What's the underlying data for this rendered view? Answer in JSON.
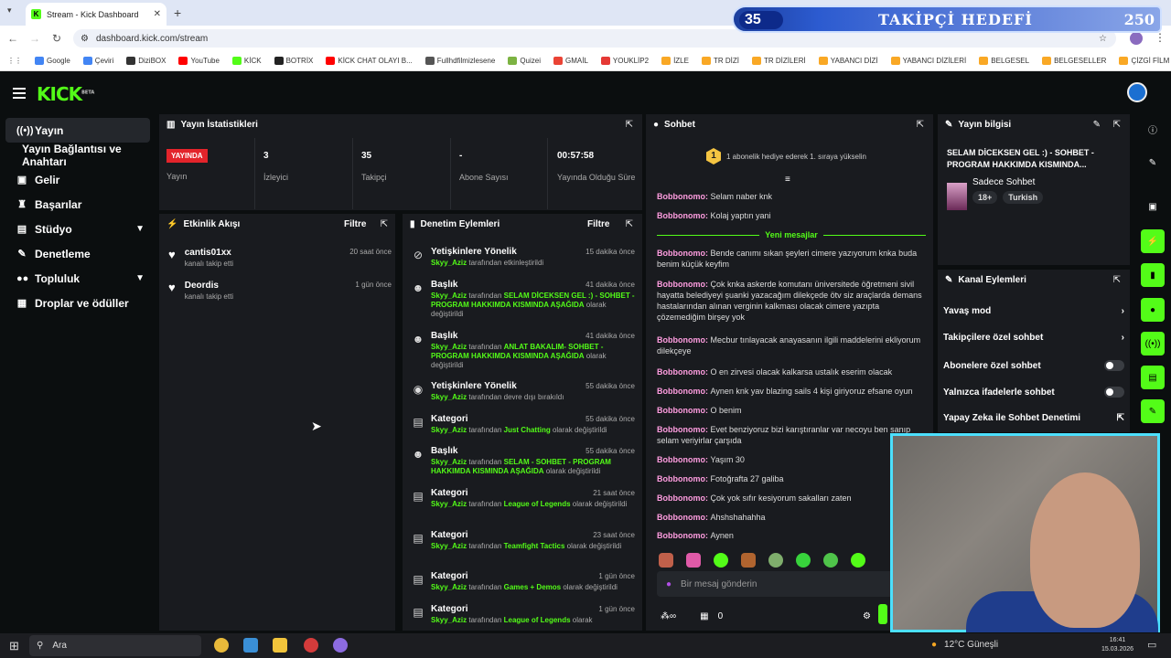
{
  "browser": {
    "tab_title": "Stream - Kick Dashboard",
    "url": "dashboard.kick.com/stream",
    "bookmarks": [
      {
        "label": "Google",
        "color": "#4285f4"
      },
      {
        "label": "Çeviri",
        "color": "#4285f4"
      },
      {
        "label": "DiziBOX",
        "color": "#333333"
      },
      {
        "label": "YouTube",
        "color": "#ff0000"
      },
      {
        "label": "KİCK",
        "color": "#53fc18"
      },
      {
        "label": "BOTRİX",
        "color": "#222222"
      },
      {
        "label": "KİCK CHAT OLAYI B...",
        "color": "#ff0000"
      },
      {
        "label": "Fullhdfilmizlesene",
        "color": "#555555"
      },
      {
        "label": "Quizei",
        "color": "#7cb342"
      },
      {
        "label": "GMAİL",
        "color": "#ea4335"
      },
      {
        "label": "YOUKLİP2",
        "color": "#e53935"
      },
      {
        "label": "İZLE",
        "color": "#f9a825"
      },
      {
        "label": "TR DİZİ",
        "color": "#f9a825"
      },
      {
        "label": "TR DİZİLERİ",
        "color": "#f9a825"
      },
      {
        "label": "YABANCI DİZİ",
        "color": "#f9a825"
      },
      {
        "label": "YABANCI DİZİLERİ",
        "color": "#f9a825"
      },
      {
        "label": "BELGESEL",
        "color": "#f9a825"
      },
      {
        "label": "BELGESELLER",
        "color": "#f9a825"
      },
      {
        "label": "ÇİZGİ FİLM",
        "color": "#f9a825"
      }
    ]
  },
  "overlay": {
    "goal_count": "35",
    "goal_label": "TAKİPÇİ HEDEFİ",
    "goal_target": "250"
  },
  "brand": {
    "logo": "KICK",
    "beta": "BETA",
    "accent": "#53fc18"
  },
  "sidebar": {
    "items": [
      {
        "label": "Yayın",
        "icon": "live-icon"
      },
      {
        "label": "Yayın Bağlantısı ve Anahtarı",
        "icon": ""
      },
      {
        "label": "Gelir",
        "icon": "wallet-icon"
      },
      {
        "label": "Başarılar",
        "icon": "trophy-icon"
      },
      {
        "label": "Stüdyo",
        "icon": "studio-icon"
      },
      {
        "label": "Denetleme",
        "icon": "wrench-icon"
      },
      {
        "label": "Topluluk",
        "icon": "community-icon"
      },
      {
        "label": "Droplar ve ödüller",
        "icon": "gift-icon"
      }
    ]
  },
  "stats": {
    "title": "Yayın İstatistikleri",
    "live_badge": "YAYINDA",
    "cols": [
      {
        "value": "",
        "label": "Yayın"
      },
      {
        "value": "3",
        "label": "İzleyici"
      },
      {
        "value": "35",
        "label": "Takipçi"
      },
      {
        "value": "-",
        "label": "Abone Sayısı"
      },
      {
        "value": "00:57:58",
        "label": "Yayında Olduğu Süre"
      }
    ]
  },
  "events": {
    "title": "Etkinlik Akışı",
    "filter": "Filtre",
    "items": [
      {
        "name": "cantis01xx",
        "sub": "kanalı takip etti",
        "time": "20 saat önce"
      },
      {
        "name": "Deordis",
        "sub": "kanalı takip etti",
        "time": "1 gün önce"
      }
    ]
  },
  "mod": {
    "title": "Denetim Eylemleri",
    "filter": "Filtre",
    "items": [
      {
        "title": "Yetişkinlere Yönelik",
        "time": "15 dakika önce",
        "user": "Skyy_Aziz",
        "pre": " tarafından etkinleştirildi",
        "val": "",
        "post": ""
      },
      {
        "title": "Başlık",
        "time": "41 dakika önce",
        "user": "Skyy_Aziz",
        "pre": " tarafından ",
        "val": "SELAM DİCEKSEN GEL :) - SOHBET - PROGRAM HAKKIMDA KISMINDA AŞAĞIDA",
        "post": " olarak değiştirildi"
      },
      {
        "title": "Başlık",
        "time": "41 dakika önce",
        "user": "Skyy_Aziz",
        "pre": " tarafından ",
        "val": "ANLAT BAKALIM- SOHBET - PROGRAM HAKKIMDA KISMINDA AŞAĞIDA",
        "post": " olarak değiştirildi"
      },
      {
        "title": "Yetişkinlere Yönelik",
        "time": "55 dakika önce",
        "user": "Skyy_Aziz",
        "pre": " tarafından devre dışı bırakıldı",
        "val": "",
        "post": ""
      },
      {
        "title": "Kategori",
        "time": "55 dakika önce",
        "user": "Skyy_Aziz",
        "pre": " tarafından ",
        "val": "Just Chatting",
        "post": " olarak değiştirildi"
      },
      {
        "title": "Başlık",
        "time": "55 dakika önce",
        "user": "Skyy_Aziz",
        "pre": " tarafından ",
        "val": "SELAM - SOHBET - PROGRAM HAKKIMDA KISMINDA AŞAĞIDA",
        "post": " olarak değiştirildi"
      },
      {
        "title": "Kategori",
        "time": "21 saat önce",
        "user": "Skyy_Aziz",
        "pre": " tarafından ",
        "val": "League of Legends",
        "post": " olarak değiştirildi"
      },
      {
        "title": "Kategori",
        "time": "23 saat önce",
        "user": "Skyy_Aziz",
        "pre": " tarafından ",
        "val": "Teamfight Tactics",
        "post": " olarak değiştirildi"
      },
      {
        "title": "Kategori",
        "time": "1 gün önce",
        "user": "Skyy_Aziz",
        "pre": " tarafından ",
        "val": "Games + Demos",
        "post": " olarak değiştirildi"
      },
      {
        "title": "Kategori",
        "time": "1 gün önce",
        "user": "Skyy_Aziz",
        "pre": " tarafından ",
        "val": "League of Legends",
        "post": " olarak"
      }
    ]
  },
  "chat": {
    "title": "Sohbet",
    "notice_num": "1",
    "notice": "1 abonelik hediye ederek 1. sıraya yükselin",
    "new_messages": "Yeni mesajlar",
    "placeholder": "Bir mesaj gönderin",
    "points": "0",
    "messages": [
      {
        "user": "Bobbonomo",
        "text": "Selam naber knk"
      },
      {
        "user": "Bobbonomo",
        "text": "Kolaj yaptın yani"
      },
      {
        "user": "Bobbonomo",
        "text": "Bende canımı sıkan şeyleri cimere yazıyorum knka buda benim küçük keyfim"
      },
      {
        "user": "Bobbonomo",
        "text": "Çok knka askerde komutanı üniversitede öğretmeni sivil hayatta belediyeyi şuanki yazacağım dilekçede ötv siz araçlarda demans hastalarından alınan verginin kalkması olacak cimere yazıpta çözemediğim birşey yok"
      },
      {
        "user": "Bobbonomo",
        "text": "Mecbur tınlayacak anayasanın ilgili maddelerini ekliyorum dilekçeye"
      },
      {
        "user": "Bobbonomo",
        "text": "O en zirvesi olacak kalkarsa ustalık eserim olacak"
      },
      {
        "user": "Bobbonomo",
        "text": "Aynen knk yav blazing sails 4 kişi giriyoruz efsane oyun"
      },
      {
        "user": "Bobbonomo",
        "text": "O benim"
      },
      {
        "user": "Bobbonomo",
        "text": "Evet benziyoruz bizi karıştıranlar var necoyu ben sanıp selam veriyirlar çarşıda"
      },
      {
        "user": "Bobbonomo",
        "text": "Yaşım 30"
      },
      {
        "user": "Bobbonomo",
        "text": "Fotoğrafta 27 galiba"
      },
      {
        "user": "Bobbonomo",
        "text": "Çok yok sıfır kesiyorum sakalları zaten"
      },
      {
        "user": "Bobbonomo",
        "text": "Ahshshahahha"
      },
      {
        "user": "Bobbonomo",
        "text": "Aynen"
      }
    ]
  },
  "stream_info": {
    "title": "Yayın bilgisi",
    "stream_title": "SELAM DİCEKSEN GEL :) - SOHBET - PROGRAM HAKKIMDA KISMINDA...",
    "category": "Sadece Sohbet",
    "tags": [
      "18+",
      "Turkish"
    ]
  },
  "channel_actions": {
    "title": "Kanal Eylemleri",
    "rows": [
      {
        "label": "Yavaş mod",
        "kind": "chevron"
      },
      {
        "label": "Takipçilere özel sohbet",
        "kind": "chevron"
      },
      {
        "label": "Abonelere özel sohbet",
        "kind": "toggle"
      },
      {
        "label": "Yalnızca ifadelerle sohbet",
        "kind": "toggle"
      },
      {
        "label": "Yapay Zeka ile Sohbet Denetimi",
        "kind": "external"
      }
    ]
  },
  "taskbar": {
    "search": "Ara",
    "weather": "12°C Güneşli",
    "time": "16:41",
    "date": "15.03.2026"
  }
}
